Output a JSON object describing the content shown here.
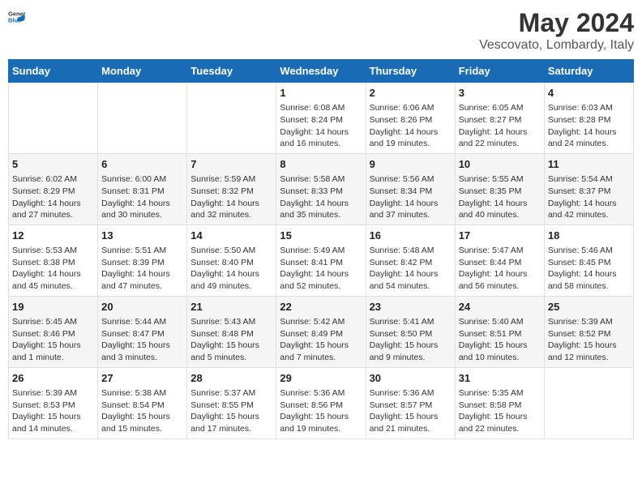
{
  "header": {
    "logo_general": "General",
    "logo_blue": "Blue",
    "title": "May 2024",
    "subtitle": "Vescovato, Lombardy, Italy"
  },
  "columns": [
    "Sunday",
    "Monday",
    "Tuesday",
    "Wednesday",
    "Thursday",
    "Friday",
    "Saturday"
  ],
  "weeks": [
    [
      {
        "day": "",
        "info": ""
      },
      {
        "day": "",
        "info": ""
      },
      {
        "day": "",
        "info": ""
      },
      {
        "day": "1",
        "info": "Sunrise: 6:08 AM\nSunset: 8:24 PM\nDaylight: 14 hours and 16 minutes."
      },
      {
        "day": "2",
        "info": "Sunrise: 6:06 AM\nSunset: 8:26 PM\nDaylight: 14 hours and 19 minutes."
      },
      {
        "day": "3",
        "info": "Sunrise: 6:05 AM\nSunset: 8:27 PM\nDaylight: 14 hours and 22 minutes."
      },
      {
        "day": "4",
        "info": "Sunrise: 6:03 AM\nSunset: 8:28 PM\nDaylight: 14 hours and 24 minutes."
      }
    ],
    [
      {
        "day": "5",
        "info": "Sunrise: 6:02 AM\nSunset: 8:29 PM\nDaylight: 14 hours and 27 minutes."
      },
      {
        "day": "6",
        "info": "Sunrise: 6:00 AM\nSunset: 8:31 PM\nDaylight: 14 hours and 30 minutes."
      },
      {
        "day": "7",
        "info": "Sunrise: 5:59 AM\nSunset: 8:32 PM\nDaylight: 14 hours and 32 minutes."
      },
      {
        "day": "8",
        "info": "Sunrise: 5:58 AM\nSunset: 8:33 PM\nDaylight: 14 hours and 35 minutes."
      },
      {
        "day": "9",
        "info": "Sunrise: 5:56 AM\nSunset: 8:34 PM\nDaylight: 14 hours and 37 minutes."
      },
      {
        "day": "10",
        "info": "Sunrise: 5:55 AM\nSunset: 8:35 PM\nDaylight: 14 hours and 40 minutes."
      },
      {
        "day": "11",
        "info": "Sunrise: 5:54 AM\nSunset: 8:37 PM\nDaylight: 14 hours and 42 minutes."
      }
    ],
    [
      {
        "day": "12",
        "info": "Sunrise: 5:53 AM\nSunset: 8:38 PM\nDaylight: 14 hours and 45 minutes."
      },
      {
        "day": "13",
        "info": "Sunrise: 5:51 AM\nSunset: 8:39 PM\nDaylight: 14 hours and 47 minutes."
      },
      {
        "day": "14",
        "info": "Sunrise: 5:50 AM\nSunset: 8:40 PM\nDaylight: 14 hours and 49 minutes."
      },
      {
        "day": "15",
        "info": "Sunrise: 5:49 AM\nSunset: 8:41 PM\nDaylight: 14 hours and 52 minutes."
      },
      {
        "day": "16",
        "info": "Sunrise: 5:48 AM\nSunset: 8:42 PM\nDaylight: 14 hours and 54 minutes."
      },
      {
        "day": "17",
        "info": "Sunrise: 5:47 AM\nSunset: 8:44 PM\nDaylight: 14 hours and 56 minutes."
      },
      {
        "day": "18",
        "info": "Sunrise: 5:46 AM\nSunset: 8:45 PM\nDaylight: 14 hours and 58 minutes."
      }
    ],
    [
      {
        "day": "19",
        "info": "Sunrise: 5:45 AM\nSunset: 8:46 PM\nDaylight: 15 hours and 1 minute."
      },
      {
        "day": "20",
        "info": "Sunrise: 5:44 AM\nSunset: 8:47 PM\nDaylight: 15 hours and 3 minutes."
      },
      {
        "day": "21",
        "info": "Sunrise: 5:43 AM\nSunset: 8:48 PM\nDaylight: 15 hours and 5 minutes."
      },
      {
        "day": "22",
        "info": "Sunrise: 5:42 AM\nSunset: 8:49 PM\nDaylight: 15 hours and 7 minutes."
      },
      {
        "day": "23",
        "info": "Sunrise: 5:41 AM\nSunset: 8:50 PM\nDaylight: 15 hours and 9 minutes."
      },
      {
        "day": "24",
        "info": "Sunrise: 5:40 AM\nSunset: 8:51 PM\nDaylight: 15 hours and 10 minutes."
      },
      {
        "day": "25",
        "info": "Sunrise: 5:39 AM\nSunset: 8:52 PM\nDaylight: 15 hours and 12 minutes."
      }
    ],
    [
      {
        "day": "26",
        "info": "Sunrise: 5:39 AM\nSunset: 8:53 PM\nDaylight: 15 hours and 14 minutes."
      },
      {
        "day": "27",
        "info": "Sunrise: 5:38 AM\nSunset: 8:54 PM\nDaylight: 15 hours and 15 minutes."
      },
      {
        "day": "28",
        "info": "Sunrise: 5:37 AM\nSunset: 8:55 PM\nDaylight: 15 hours and 17 minutes."
      },
      {
        "day": "29",
        "info": "Sunrise: 5:36 AM\nSunset: 8:56 PM\nDaylight: 15 hours and 19 minutes."
      },
      {
        "day": "30",
        "info": "Sunrise: 5:36 AM\nSunset: 8:57 PM\nDaylight: 15 hours and 21 minutes."
      },
      {
        "day": "31",
        "info": "Sunrise: 5:35 AM\nSunset: 8:58 PM\nDaylight: 15 hours and 22 minutes."
      },
      {
        "day": "",
        "info": ""
      }
    ]
  ]
}
